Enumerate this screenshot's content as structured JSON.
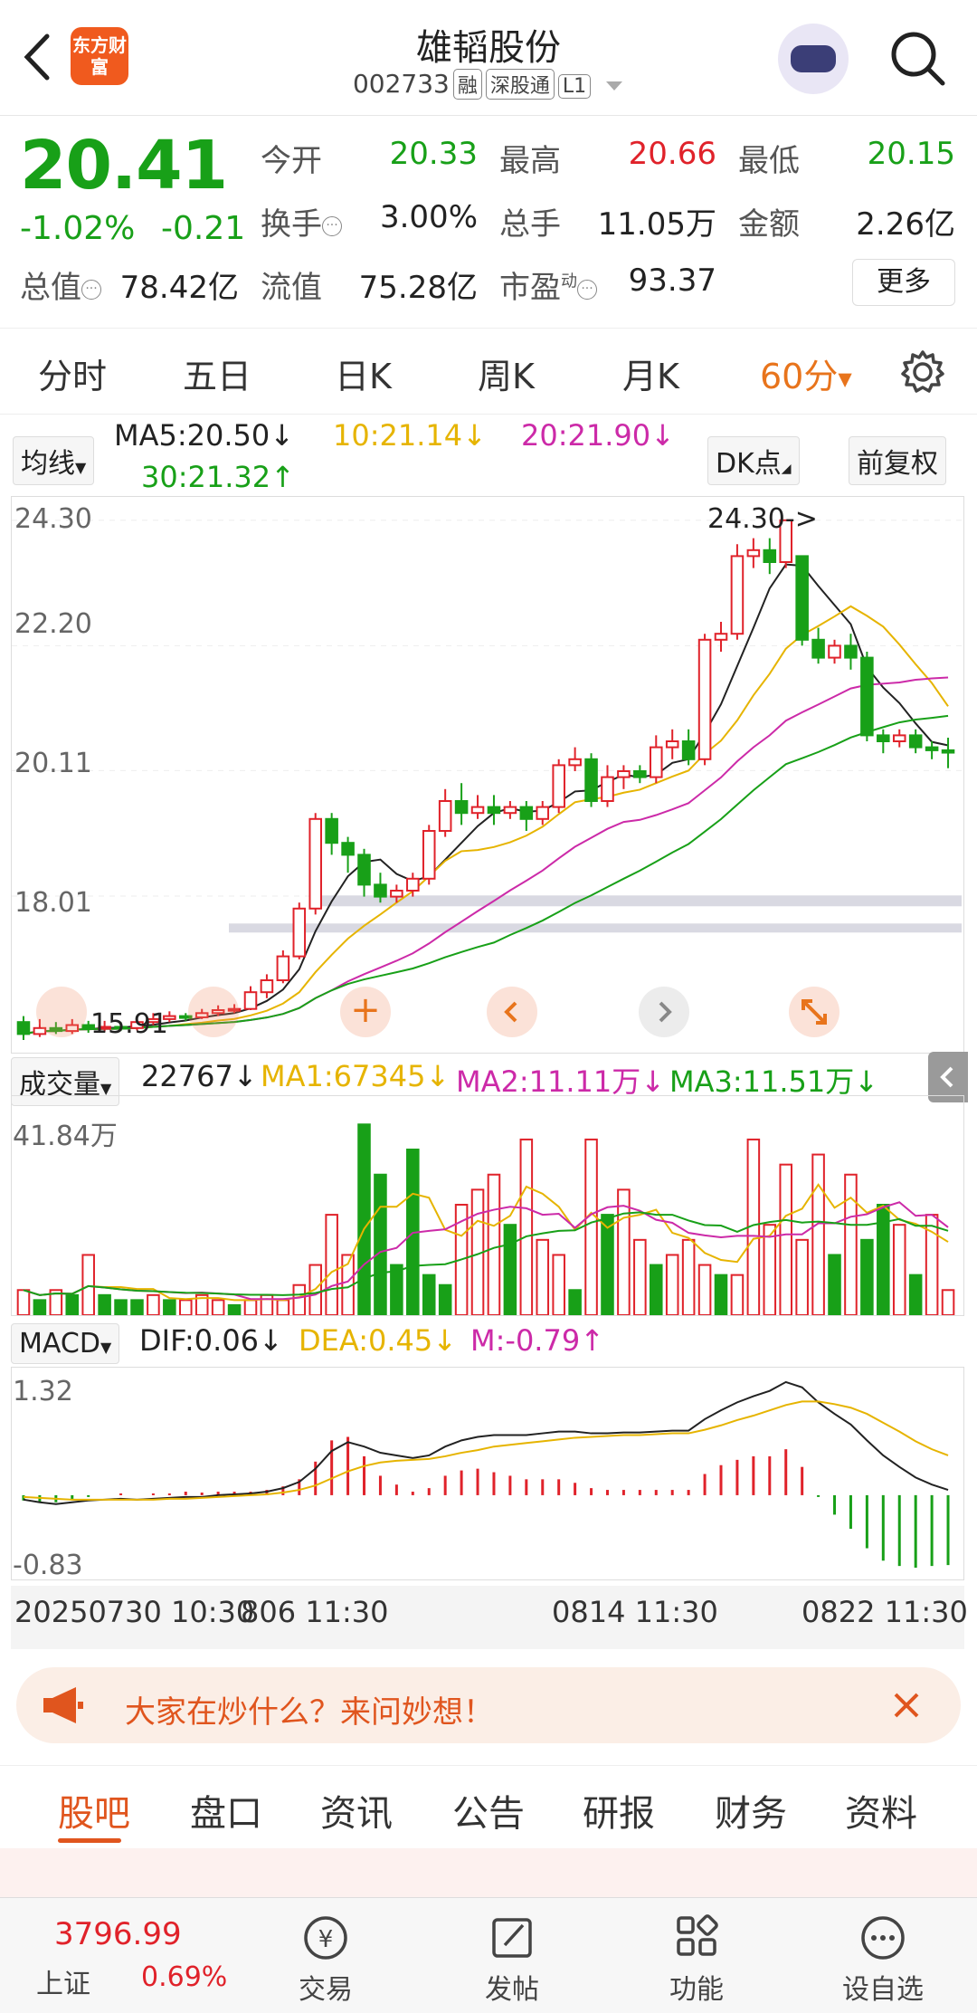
{
  "header": {
    "title": "雄韬股份",
    "code": "002733",
    "tags": [
      "融",
      "深股通",
      "L1"
    ],
    "logo_text": "东方财富"
  },
  "quote": {
    "price": "20.41",
    "pct": "-1.02%",
    "change": "-0.21",
    "open_label": "今开",
    "open": "20.33",
    "high_label": "最高",
    "high": "20.66",
    "low_label": "最低",
    "low": "20.15",
    "turnover_label": "换手",
    "turnover": "3.00%",
    "volume_label": "总手",
    "volume": "11.05万",
    "amount_label": "金额",
    "amount": "2.26亿",
    "mcap_label": "总值",
    "mcap": "78.42亿",
    "float_label": "流值",
    "float": "75.28亿",
    "pe_label": "市盈",
    "pe_sup": "动",
    "pe": "93.37",
    "more": "更多"
  },
  "tabs": [
    "分时",
    "五日",
    "日K",
    "周K",
    "月K",
    "60分"
  ],
  "active_tab": "60分",
  "ma_row": {
    "select": "均线",
    "ma5": "MA5:20.50↓",
    "ma10": "10:21.14↓",
    "ma20": "20:21.90↓",
    "ma30": "30:21.32↑",
    "dk": "DK点",
    "adjust": "前复权"
  },
  "colors": {
    "up": "#e0222a",
    "down": "#18a018",
    "accent": "#e8741c",
    "ma5": "#222222",
    "ma10": "#e6b400",
    "ma20": "#cc2aa8",
    "ma30": "#18a018"
  },
  "chart_data": [
    {
      "type": "candlestick",
      "title": "",
      "y_ticks": [
        "24.30",
        "22.20",
        "20.11",
        "18.01"
      ],
      "annotations": [
        "24.30->",
        "15.91"
      ],
      "ylim": [
        15.6,
        24.6
      ],
      "candles": [
        [
          15.9,
          15.7,
          16.0,
          15.6
        ],
        [
          15.7,
          15.8,
          15.95,
          15.65
        ],
        [
          15.8,
          15.75,
          15.9,
          15.7
        ],
        [
          15.75,
          15.85,
          15.95,
          15.7
        ],
        [
          15.85,
          15.8,
          15.92,
          15.72
        ],
        [
          15.8,
          15.82,
          15.92,
          15.74
        ],
        [
          15.82,
          15.8,
          15.9,
          15.75
        ],
        [
          15.8,
          15.9,
          15.98,
          15.76
        ],
        [
          15.9,
          15.95,
          16.05,
          15.85
        ],
        [
          15.95,
          16.0,
          16.08,
          15.9
        ],
        [
          16.0,
          15.98,
          16.05,
          15.92
        ],
        [
          15.98,
          16.05,
          16.12,
          15.95
        ],
        [
          16.05,
          16.1,
          16.18,
          16.0
        ],
        [
          16.1,
          16.12,
          16.2,
          16.05
        ],
        [
          16.12,
          16.4,
          16.5,
          16.1
        ],
        [
          16.4,
          16.6,
          16.7,
          16.3
        ],
        [
          16.6,
          17.0,
          17.1,
          16.55
        ],
        [
          17.0,
          17.8,
          17.9,
          16.95
        ],
        [
          17.8,
          19.3,
          19.4,
          17.7
        ],
        [
          19.3,
          18.9,
          19.4,
          18.7
        ],
        [
          18.9,
          18.7,
          19.0,
          18.4
        ],
        [
          18.7,
          18.2,
          18.8,
          18.0
        ],
        [
          18.2,
          18.0,
          18.4,
          17.9
        ],
        [
          18.0,
          18.1,
          18.2,
          17.9
        ],
        [
          18.1,
          18.3,
          18.4,
          18.0
        ],
        [
          18.3,
          19.1,
          19.2,
          18.2
        ],
        [
          19.1,
          19.6,
          19.8,
          19.0
        ],
        [
          19.6,
          19.4,
          19.9,
          19.2
        ],
        [
          19.4,
          19.5,
          19.7,
          19.3
        ],
        [
          19.5,
          19.4,
          19.7,
          19.2
        ],
        [
          19.4,
          19.5,
          19.6,
          19.3
        ],
        [
          19.5,
          19.3,
          19.6,
          19.1
        ],
        [
          19.3,
          19.5,
          19.6,
          19.2
        ],
        [
          19.5,
          20.2,
          20.3,
          19.4
        ],
        [
          20.2,
          20.3,
          20.5,
          20.1
        ],
        [
          20.3,
          19.6,
          20.4,
          19.5
        ],
        [
          19.6,
          20.0,
          20.2,
          19.5
        ],
        [
          20.0,
          20.1,
          20.2,
          19.8
        ],
        [
          20.1,
          20.0,
          20.2,
          19.9
        ],
        [
          20.0,
          20.5,
          20.7,
          19.9
        ],
        [
          20.5,
          20.6,
          20.8,
          20.3
        ],
        [
          20.6,
          20.3,
          20.8,
          20.2
        ],
        [
          20.3,
          22.3,
          22.4,
          20.2
        ],
        [
          22.3,
          22.4,
          22.6,
          22.1
        ],
        [
          22.4,
          23.7,
          23.9,
          22.3
        ],
        [
          23.7,
          23.8,
          24.0,
          23.5
        ],
        [
          23.8,
          23.6,
          24.0,
          23.4
        ],
        [
          23.6,
          24.3,
          24.3,
          23.5
        ],
        [
          23.7,
          22.3,
          23.7,
          22.2
        ],
        [
          22.3,
          22.0,
          22.5,
          21.9
        ],
        [
          22.0,
          22.2,
          22.3,
          21.9
        ],
        [
          22.2,
          22.0,
          22.4,
          21.8
        ],
        [
          22.0,
          20.7,
          22.1,
          20.6
        ],
        [
          20.7,
          20.6,
          20.8,
          20.4
        ],
        [
          20.6,
          20.7,
          20.8,
          20.5
        ],
        [
          20.7,
          20.5,
          20.8,
          20.4
        ],
        [
          20.5,
          20.45,
          20.6,
          20.3
        ],
        [
          20.45,
          20.41,
          20.66,
          20.15
        ]
      ]
    },
    {
      "type": "bar",
      "title": "",
      "select": "成交量",
      "latest": "22767↓",
      "ma1": "MA1:67345↓",
      "ma2": "MA2:11.11万↓",
      "ma3": "MA3:11.51万↓",
      "y_top_label": "41.84万",
      "ylim": [
        0,
        41.84
      ],
      "values": [
        5,
        3,
        5,
        4,
        12,
        4,
        3,
        3,
        4,
        3,
        3,
        4,
        3,
        2,
        3,
        4,
        3,
        6,
        10,
        20,
        12,
        38,
        28,
        10,
        33,
        8,
        6,
        22,
        25,
        28,
        18,
        35,
        15,
        12,
        5,
        35,
        20,
        25,
        15,
        10,
        12,
        15,
        10,
        8,
        8,
        35,
        18,
        30,
        15,
        32,
        12,
        28,
        15,
        22,
        18,
        8,
        20,
        5
      ],
      "up": [
        1,
        0,
        1,
        0,
        1,
        0,
        0,
        0,
        1,
        0,
        1,
        1,
        1,
        0,
        1,
        1,
        1,
        1,
        1,
        1,
        1,
        0,
        0,
        0,
        0,
        0,
        0,
        1,
        1,
        1,
        0,
        1,
        1,
        1,
        0,
        1,
        0,
        1,
        1,
        0,
        1,
        1,
        1,
        0,
        1,
        1,
        1,
        1,
        1,
        1,
        0,
        1,
        0,
        0,
        1,
        0,
        1,
        1
      ]
    },
    {
      "type": "line",
      "title": "",
      "select": "MACD",
      "dif": "DIF:0.06↓",
      "dea": "DEA:0.45↓",
      "m": "M:-0.79↑",
      "y_ticks": [
        "1.32",
        "-0.83"
      ],
      "ylim": [
        -0.83,
        1.32
      ],
      "x_ticks": [
        "20250730 10:30",
        "806 11:30",
        "0814 11:30",
        "0822 11:30"
      ],
      "dif_values": [
        -0.05,
        -0.08,
        -0.1,
        -0.08,
        -0.06,
        -0.05,
        -0.04,
        -0.05,
        -0.04,
        -0.03,
        -0.02,
        -0.02,
        0.0,
        0.01,
        0.02,
        0.04,
        0.08,
        0.15,
        0.3,
        0.5,
        0.6,
        0.55,
        0.48,
        0.45,
        0.42,
        0.45,
        0.55,
        0.62,
        0.66,
        0.68,
        0.68,
        0.68,
        0.7,
        0.72,
        0.72,
        0.7,
        0.7,
        0.71,
        0.71,
        0.72,
        0.73,
        0.73,
        0.86,
        0.96,
        1.05,
        1.12,
        1.18,
        1.28,
        1.22,
        1.05,
        0.92,
        0.8,
        0.62,
        0.45,
        0.32,
        0.2,
        0.12,
        0.06
      ],
      "dea_values": [
        -0.02,
        -0.03,
        -0.04,
        -0.05,
        -0.05,
        -0.05,
        -0.05,
        -0.05,
        -0.05,
        -0.04,
        -0.04,
        -0.03,
        -0.02,
        -0.01,
        0.0,
        0.01,
        0.03,
        0.06,
        0.11,
        0.19,
        0.27,
        0.33,
        0.37,
        0.39,
        0.4,
        0.41,
        0.44,
        0.48,
        0.51,
        0.55,
        0.57,
        0.59,
        0.61,
        0.63,
        0.65,
        0.66,
        0.67,
        0.68,
        0.68,
        0.69,
        0.7,
        0.7,
        0.74,
        0.79,
        0.85,
        0.9,
        0.96,
        1.02,
        1.06,
        1.06,
        1.03,
        0.99,
        0.92,
        0.82,
        0.72,
        0.61,
        0.52,
        0.45
      ],
      "m_values": [
        -0.06,
        -0.08,
        -0.08,
        -0.05,
        -0.02,
        0,
        0.02,
        0,
        0.02,
        0.02,
        0.04,
        0.03,
        0.04,
        0.04,
        0.04,
        0.06,
        0.1,
        0.18,
        0.38,
        0.62,
        0.66,
        0.44,
        0.22,
        0.12,
        0.04,
        0.08,
        0.22,
        0.28,
        0.3,
        0.26,
        0.22,
        0.18,
        0.18,
        0.18,
        0.14,
        0.08,
        0.06,
        0.06,
        0.06,
        0.06,
        0.06,
        0.06,
        0.24,
        0.34,
        0.4,
        0.44,
        0.44,
        0.52,
        0.32,
        -0.02,
        -0.22,
        -0.38,
        -0.6,
        -0.74,
        -0.8,
        -0.82,
        -0.8,
        -0.79
      ]
    }
  ],
  "chart_buttons": [
    "prev",
    "add",
    "prev2",
    "next",
    "expand"
  ],
  "banner": {
    "text": "大家在炒什么？来问妙想！"
  },
  "bottom_tabs": [
    "股吧",
    "盘口",
    "资讯",
    "公告",
    "研报",
    "财务",
    "资料"
  ],
  "bottom_bar": {
    "index_value": "3796.99",
    "index_name": "上证",
    "index_pct": "0.69%",
    "items": [
      "交易",
      "发帖",
      "功能",
      "设自选"
    ]
  }
}
